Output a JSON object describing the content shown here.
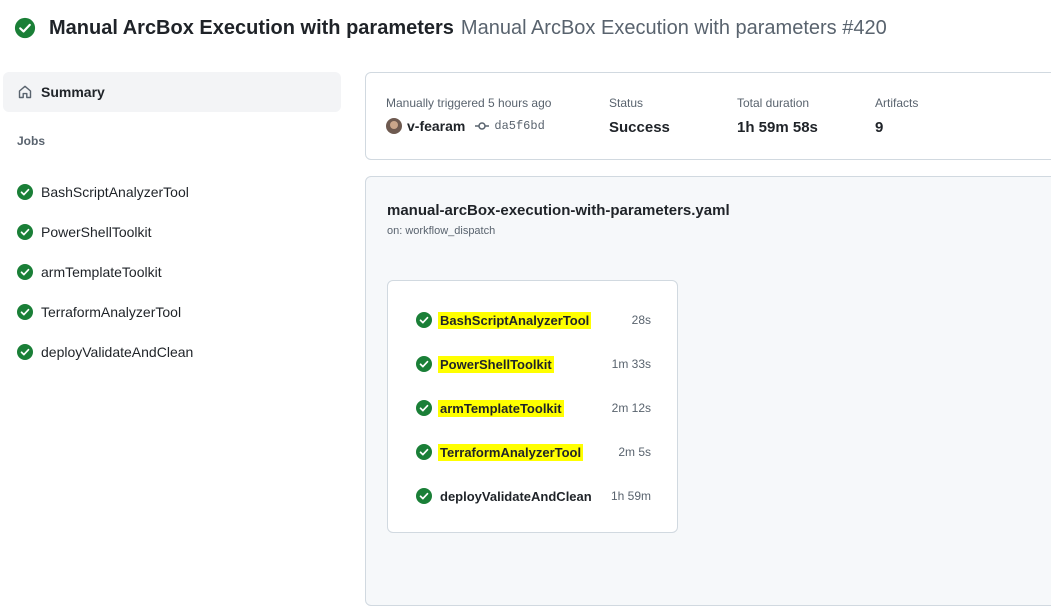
{
  "header": {
    "title": "Manual ArcBox Execution with parameters",
    "run_name": "Manual ArcBox Execution with parameters #420"
  },
  "sidebar": {
    "summary_label": "Summary",
    "jobs_heading": "Jobs",
    "jobs": [
      {
        "label": "BashScriptAnalyzerTool"
      },
      {
        "label": "PowerShellToolkit"
      },
      {
        "label": "armTemplateToolkit"
      },
      {
        "label": "TerraformAnalyzerTool"
      },
      {
        "label": "deployValidateAndClean"
      }
    ]
  },
  "summary": {
    "trigger_caption": "Manually triggered 5 hours ago",
    "actor": "v-fearam",
    "commit": "da5f6bd",
    "status_caption": "Status",
    "status_value": "Success",
    "duration_caption": "Total duration",
    "duration_value": "1h 59m 58s",
    "artifacts_caption": "Artifacts",
    "artifacts_value": "9"
  },
  "workflow": {
    "file": "manual-arcBox-execution-with-parameters.yaml",
    "trigger": "on: workflow_dispatch",
    "jobs": [
      {
        "name": "BashScriptAnalyzerTool",
        "duration": "28s",
        "highlighted": true
      },
      {
        "name": "PowerShellToolkit",
        "duration": "1m 33s",
        "highlighted": true
      },
      {
        "name": "armTemplateToolkit",
        "duration": "2m 12s",
        "highlighted": true
      },
      {
        "name": "TerraformAnalyzerTool",
        "duration": "2m 5s",
        "highlighted": true
      },
      {
        "name": "deployValidateAndClean",
        "duration": "1h 59m",
        "highlighted": false
      }
    ]
  },
  "colors": {
    "success": "#1a7f37",
    "highlight": "#ffff00"
  },
  "icons": {
    "status": "check-circle-fill-icon",
    "summary": "home-icon",
    "commit": "git-commit-icon"
  }
}
